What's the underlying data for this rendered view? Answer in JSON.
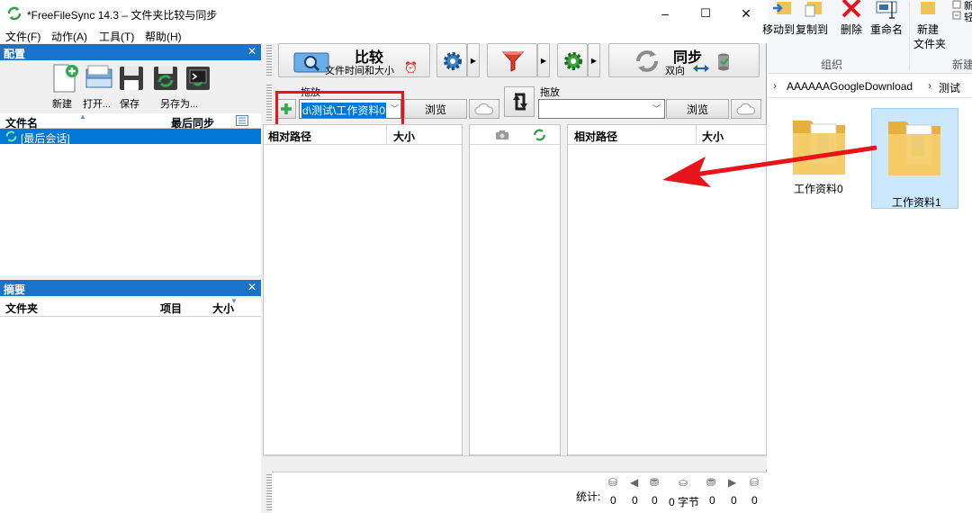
{
  "window": {
    "title": "*FreeFileSync 14.3 – 文件夹比较与同步",
    "minimize": "–",
    "maximize": "☐",
    "close": "✕"
  },
  "menu": [
    "文件(F)",
    "动作(A)",
    "工具(T)",
    "帮助(H)"
  ],
  "config_panel": {
    "title": "配置",
    "close": "✕",
    "buttons": [
      "新建",
      "打开...",
      "保存",
      "另存为..."
    ],
    "col_name": "文件名",
    "col_last_sync": "最后同步",
    "last_session": "[最后会话]"
  },
  "summary_panel": {
    "title": "摘要",
    "close": "✕",
    "col_folder": "文件夹",
    "col_items": "项目",
    "col_size": "大小"
  },
  "toolbar": {
    "compare_title": "比较",
    "compare_sub": "文件时间和大小",
    "sync_title": "同步",
    "sync_sub": "双向",
    "arrow": "▶"
  },
  "left_folder": {
    "drag_label": "拖放",
    "path": "d\\测试\\工作资料0",
    "browse": "浏览"
  },
  "right_folder": {
    "drag_label": "拖放",
    "path": "",
    "browse": "浏览"
  },
  "grid": {
    "left_col_path": "相对路径",
    "left_col_size": "大小",
    "right_col_path": "相对路径",
    "right_col_size": "大小"
  },
  "stats": {
    "label": "统计:",
    "values": [
      "0",
      "0",
      "0",
      "0 字节",
      "0",
      "0",
      "0"
    ]
  },
  "explorer": {
    "move_to": "移动到",
    "copy_to": "复制到",
    "delete": "删除",
    "rename": "重命名",
    "new_folder": "新建\n文件夹",
    "new_folder_line1": "新建",
    "new_folder_line2": "文件夹",
    "new_item": "新",
    "easy_access": "轻",
    "group_organize": "组织",
    "group_new": "新建",
    "breadcrumb_1": "AAAAAAGoogleDownload",
    "breadcrumb_sep": "›",
    "breadcrumb_2": "测试",
    "folders": [
      "工作资料0",
      "工作资料1"
    ]
  },
  "colors": {
    "panel_header": "#1a73c9",
    "selection": "#0078d7",
    "highlight_box": "#e8141c",
    "arrow": "#e8141c",
    "folder": "#f3c35a"
  }
}
